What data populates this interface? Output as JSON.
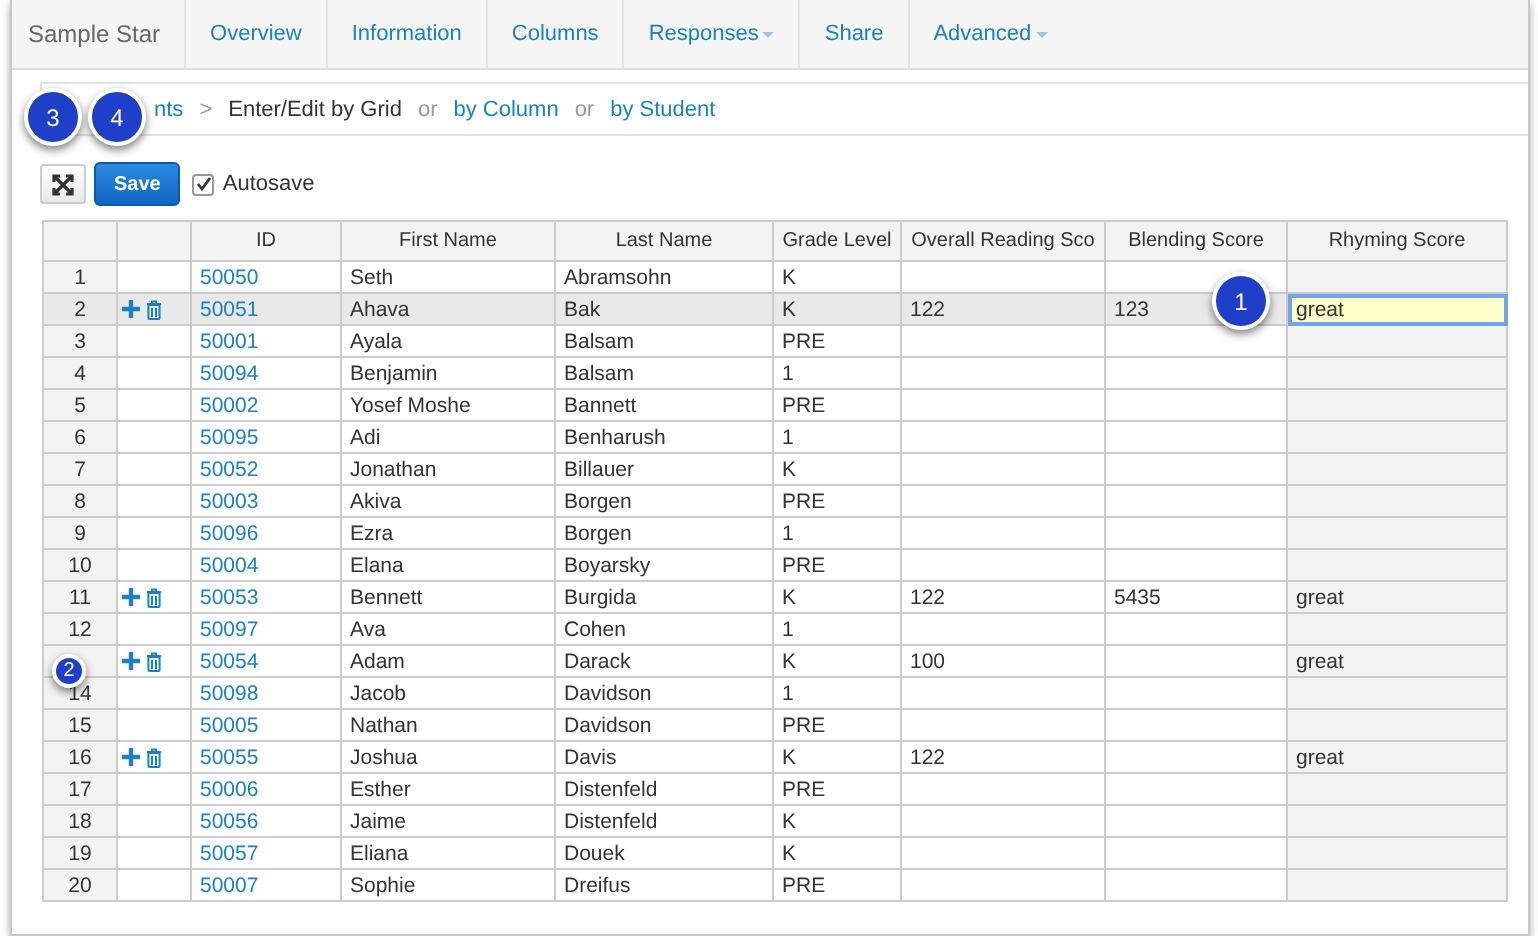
{
  "nav": {
    "brand": "Sample Star",
    "items": [
      {
        "label": "Overview",
        "dropdown": false
      },
      {
        "label": "Information",
        "dropdown": false
      },
      {
        "label": "Columns",
        "dropdown": false
      },
      {
        "label": "Responses",
        "dropdown": true
      },
      {
        "label": "Share",
        "dropdown": false
      },
      {
        "label": "Advanced",
        "dropdown": true
      }
    ]
  },
  "breadcrumb": [
    {
      "kind": "link",
      "text": "nts"
    },
    {
      "kind": "separator",
      "text": ">"
    },
    {
      "kind": "current",
      "text": "Enter/Edit by Grid"
    },
    {
      "kind": "or",
      "text": "or"
    },
    {
      "kind": "link",
      "text": "by Column"
    },
    {
      "kind": "or",
      "text": "or"
    },
    {
      "kind": "link",
      "text": "by Student"
    }
  ],
  "toolbar": {
    "save": "Save",
    "autosave": {
      "label": "Autosave",
      "checked": true
    }
  },
  "grid": {
    "columns": [
      "ID",
      "First Name",
      "Last Name",
      "Grade Level",
      "Overall Reading Sco",
      "Blending Score",
      "Rhyming Score"
    ],
    "rows": [
      {
        "number": "1",
        "selected": false,
        "actions": false,
        "cells": [
          "50050",
          "Seth",
          "Abramsohn",
          "K",
          "",
          "",
          ""
        ]
      },
      {
        "number": "2",
        "selected": true,
        "actions": true,
        "editing": true,
        "cells": [
          "50051",
          "Ahava",
          "Bak",
          "K",
          "122",
          "123",
          "great"
        ]
      },
      {
        "number": "3",
        "selected": false,
        "actions": false,
        "cells": [
          "50001",
          "Ayala",
          "Balsam",
          "PRE",
          "",
          "",
          ""
        ]
      },
      {
        "number": "4",
        "selected": false,
        "actions": false,
        "cells": [
          "50094",
          "Benjamin",
          "Balsam",
          "1",
          "",
          "",
          ""
        ]
      },
      {
        "number": "5",
        "selected": false,
        "actions": false,
        "cells": [
          "50002",
          "Yosef Moshe",
          "Bannett",
          "PRE",
          "",
          "",
          ""
        ]
      },
      {
        "number": "6",
        "selected": false,
        "actions": false,
        "cells": [
          "50095",
          "Adi",
          "Benharush",
          "1",
          "",
          "",
          ""
        ]
      },
      {
        "number": "7",
        "selected": false,
        "actions": false,
        "cells": [
          "50052",
          "Jonathan",
          "Billauer",
          "K",
          "",
          "",
          ""
        ]
      },
      {
        "number": "8",
        "selected": false,
        "actions": false,
        "cells": [
          "50003",
          "Akiva",
          "Borgen",
          "PRE",
          "",
          "",
          ""
        ]
      },
      {
        "number": "9",
        "selected": false,
        "actions": false,
        "cells": [
          "50096",
          "Ezra",
          "Borgen",
          "1",
          "",
          "",
          ""
        ]
      },
      {
        "number": "10",
        "selected": false,
        "actions": false,
        "cells": [
          "50004",
          "Elana",
          "Boyarsky",
          "PRE",
          "",
          "",
          ""
        ]
      },
      {
        "number": "11",
        "selected": false,
        "actions": true,
        "cells": [
          "50053",
          "Bennett",
          "Burgida",
          "K",
          "122",
          "5435",
          "great"
        ]
      },
      {
        "number": "12",
        "selected": false,
        "actions": false,
        "cells": [
          "50097",
          "Ava",
          "Cohen",
          "1",
          "",
          "",
          ""
        ]
      },
      {
        "selected": false,
        "actions": true,
        "cells": [
          "50054",
          "Adam",
          "Darack",
          "K",
          "100",
          "",
          "great"
        ]
      },
      {
        "number": "14",
        "selected": false,
        "actions": false,
        "cells": [
          "50098",
          "Jacob",
          "Davidson",
          "1",
          "",
          "",
          ""
        ]
      },
      {
        "number": "15",
        "selected": false,
        "actions": false,
        "cells": [
          "50005",
          "Nathan",
          "Davidson",
          "PRE",
          "",
          "",
          ""
        ]
      },
      {
        "number": "16",
        "selected": false,
        "actions": true,
        "cells": [
          "50055",
          "Joshua",
          "Davis",
          "K",
          "122",
          "",
          "great"
        ]
      },
      {
        "number": "17",
        "selected": false,
        "actions": false,
        "cells": [
          "50006",
          "Esther",
          "Distenfeld",
          "PRE",
          "",
          "",
          ""
        ]
      },
      {
        "number": "18",
        "selected": false,
        "actions": false,
        "cells": [
          "50056",
          "Jaime",
          "Distenfeld",
          "K",
          "",
          "",
          ""
        ]
      },
      {
        "number": "19",
        "selected": false,
        "actions": false,
        "cells": [
          "50057",
          "Eliana",
          "Douek",
          "K",
          "",
          "",
          ""
        ]
      },
      {
        "number": "20",
        "selected": false,
        "actions": false,
        "cells": [
          "50007",
          "Sophie",
          "Dreifus",
          "PRE",
          "",
          "",
          ""
        ]
      }
    ]
  },
  "callouts": [
    {
      "label": "1"
    },
    {
      "label": "2"
    },
    {
      "label": "3"
    },
    {
      "label": "4"
    }
  ]
}
